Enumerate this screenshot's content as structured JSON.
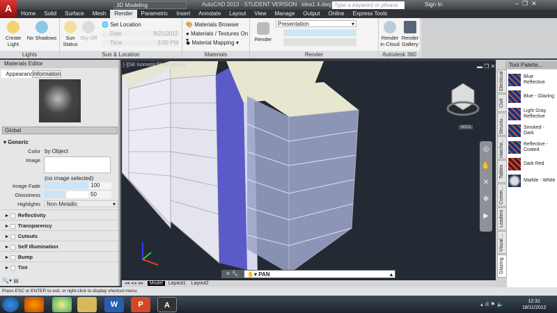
{
  "titlebar": {
    "app_title": "AutoCAD 2013 - STUDENT VERSION",
    "file": "idea1.4.dwg",
    "workspace": "3D Modeling",
    "search_placeholder": "Type a keyword or phrase",
    "sign_in": "Sign In"
  },
  "tabs": [
    "Home",
    "Solid",
    "Surface",
    "Mesh",
    "Render",
    "Parametric",
    "Insert",
    "Annotate",
    "Layout",
    "View",
    "Manage",
    "Output",
    "Online",
    "Express Tools"
  ],
  "active_tab": "Render",
  "ribbon": {
    "lights": {
      "label": "Lights",
      "create_light": "Create Light",
      "no_shadows": "No Shadows"
    },
    "sun": {
      "label": "Sun & Location",
      "sun_status": "Sun Status",
      "sky_off": "Sky Off",
      "set_location": "Set Location",
      "date_label": "Date",
      "date": "9/21/2012",
      "time_label": "Time",
      "time": "3:00 PM"
    },
    "materials": {
      "label": "Materials",
      "browser": "Materials Browser",
      "textures": "Materials / Textures On",
      "mapping": "Material Mapping"
    },
    "render": {
      "label": "Render",
      "render_btn": "Render",
      "preset": "Presentation"
    },
    "a360": {
      "label": "Autodesk 360",
      "cloud": "Render in Cloud",
      "gallery": "Render Gallery"
    }
  },
  "materials_editor": {
    "title": "Materials Editor",
    "tabs": [
      "Appearance",
      "Information"
    ],
    "name": "Global",
    "generic": "Generic",
    "color_label": "Color",
    "color_value": "by Object",
    "image_label": "Image",
    "no_image": "(no image selected)",
    "fade_label": "Image Fade",
    "fade_value": "100",
    "gloss_label": "Glossiness",
    "gloss_value": "50",
    "highlights_label": "Highlights",
    "highlights_value": "Non-Metallic",
    "sections": [
      "Reflectivity",
      "Transparency",
      "Cutouts",
      "Self Illumination",
      "Bump",
      "Tint"
    ]
  },
  "viewport": {
    "label": "[-][SE Isometric][Conceptual]",
    "wcs": "WCS",
    "command": "PAN"
  },
  "layout_tabs": [
    "Model",
    "Layout1",
    "Layout2"
  ],
  "tool_palette": {
    "title": "Tool Palette...",
    "tabs": [
      "Electrical",
      "Civil",
      "Structu...",
      "Hatche...",
      "Tables",
      "Comm...",
      "Leaders",
      "Visual ...",
      "Glazing"
    ],
    "items": [
      "Blue Reflective",
      "Blue - Glazing",
      "Light Gray Reflective",
      "Smoked - Dark",
      "Reflective - Coated",
      "Dark Red",
      "Marble - White"
    ]
  },
  "status": "Press ESC or ENTER to exit, or right-click to display shortcut menu.",
  "clock": {
    "time": "12:31",
    "date": "18/11/2012"
  }
}
